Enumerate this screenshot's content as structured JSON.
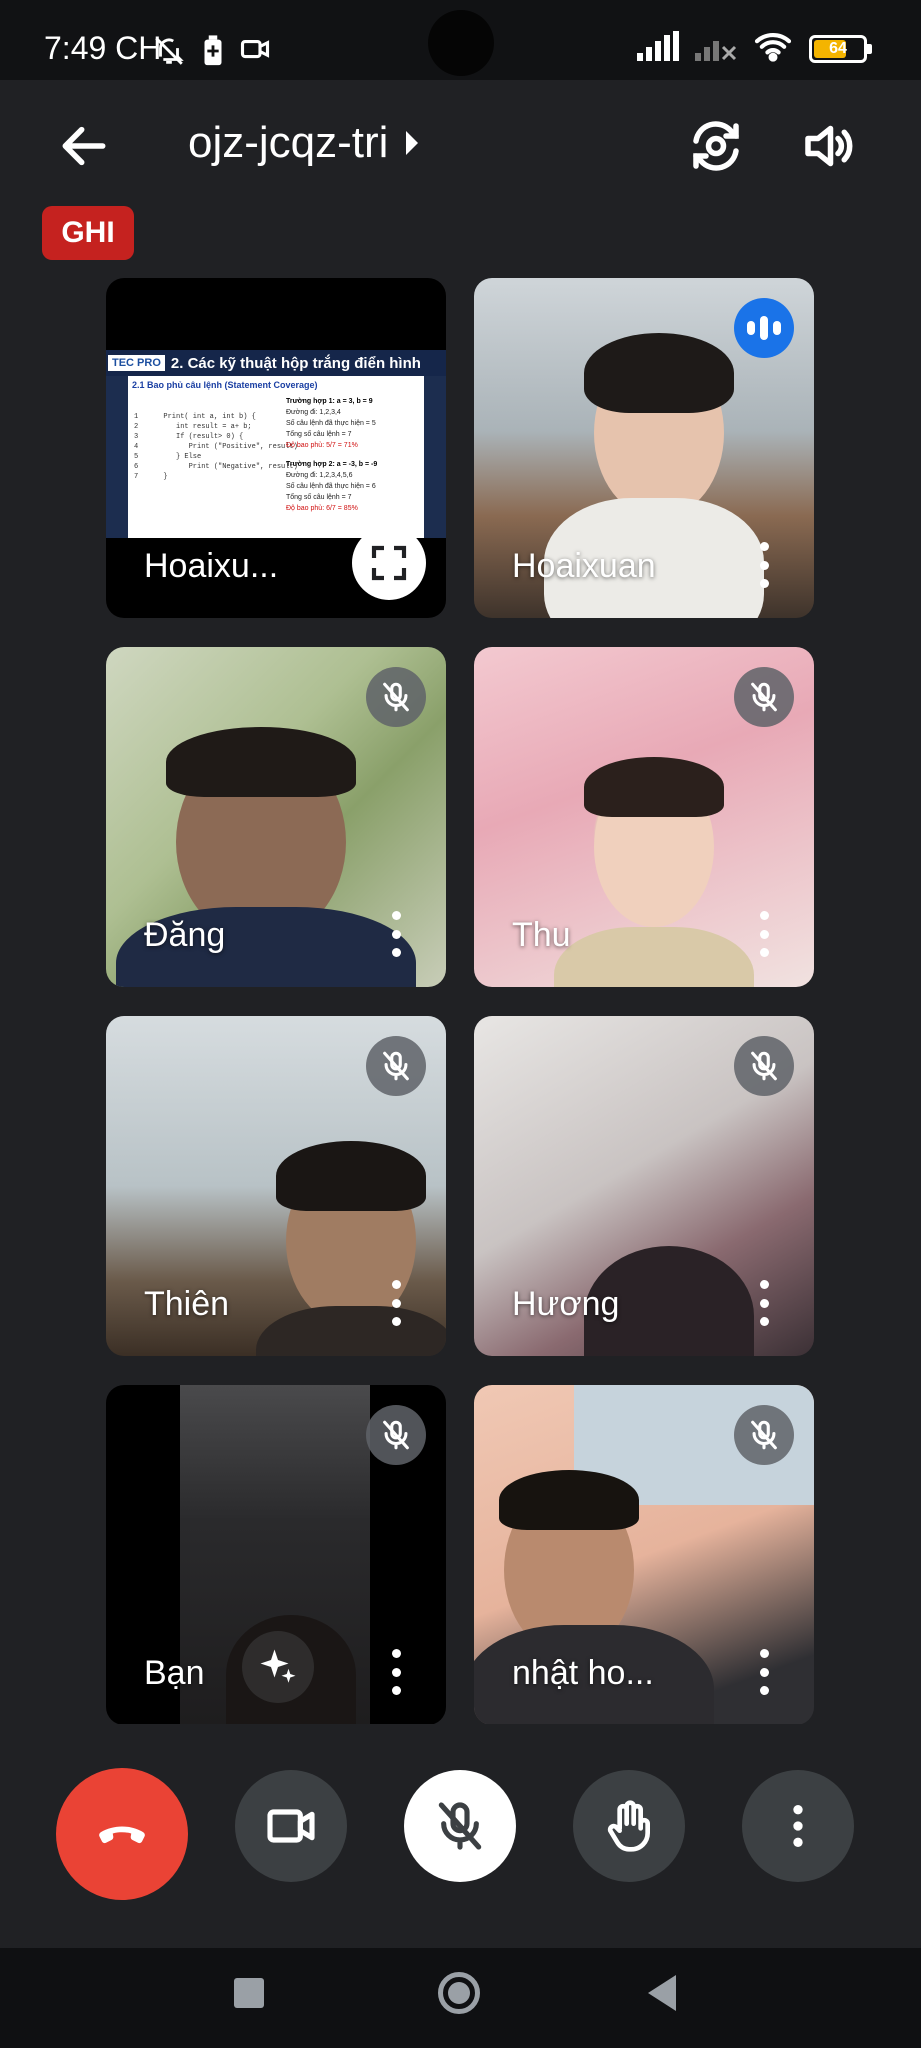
{
  "status_bar": {
    "time": "7:49 CH",
    "battery_level": "64",
    "icons": [
      "bell-off-icon",
      "battery-saver-icon",
      "video-record-icon",
      "signal-icon",
      "signal-no-sim-icon",
      "wifi-icon",
      "battery-icon"
    ]
  },
  "header": {
    "meeting_code": "ojz-jcqz-tri",
    "recording_badge": "GHI",
    "icons": [
      "back-arrow-icon",
      "switch-camera-icon",
      "speaker-icon"
    ]
  },
  "presentation": {
    "presenter_label": "Hoaixu...",
    "slide": {
      "logo": "TEC PRO",
      "title": "2. Các kỹ thuật hộp trắng điển hình",
      "subtitle": "2.1 Bao phủ câu lệnh (Statement Coverage)",
      "code": "1      Print( int a, int b) {\n2         int result = a+ b;\n3         If (result> 0) {\n4            Print (\"Positive\", result)\n5         } Else\n6            Print (\"Negative\", result)\n7      }",
      "case1_title": "Trường hợp 1: a = 3, b = 9",
      "case1_path": "Đường đi: 1,2,3,4",
      "case1_exec": "Số câu lệnh đã thực hiện = 5",
      "case1_total": "Tổng số câu lệnh = 7",
      "case1_cov": "Độ bao phủ: 5/7 = 71%",
      "case2_title": "Trường hợp 2: a = -3, b = -9",
      "case2_path": "Đường đi: 1,2,3,4,5,6",
      "case2_exec": "Số câu lệnh đã thực hiện = 6",
      "case2_total": "Tổng số câu lệnh = 7",
      "case2_cov": "Độ bao phủ: 6/7 = 85%"
    }
  },
  "participants": [
    {
      "name": "Hoaixuan",
      "muted": false,
      "speaking": true
    },
    {
      "name": "Đăng",
      "muted": true
    },
    {
      "name": "Thu",
      "muted": true
    },
    {
      "name": "Thiên",
      "muted": true
    },
    {
      "name": "Hương",
      "muted": true
    },
    {
      "name": "Bạn",
      "muted": true
    },
    {
      "name": "nhật ho...",
      "muted": true
    }
  ],
  "controls": {
    "end_call_color": "#ea4335",
    "icons": [
      "end-call-icon",
      "camera-icon",
      "mic-off-icon",
      "raise-hand-icon",
      "more-options-icon"
    ]
  },
  "colors": {
    "background": "#202124",
    "tile": "#3c4043",
    "record": "#c5221f",
    "speaking": "#1a73e8"
  }
}
